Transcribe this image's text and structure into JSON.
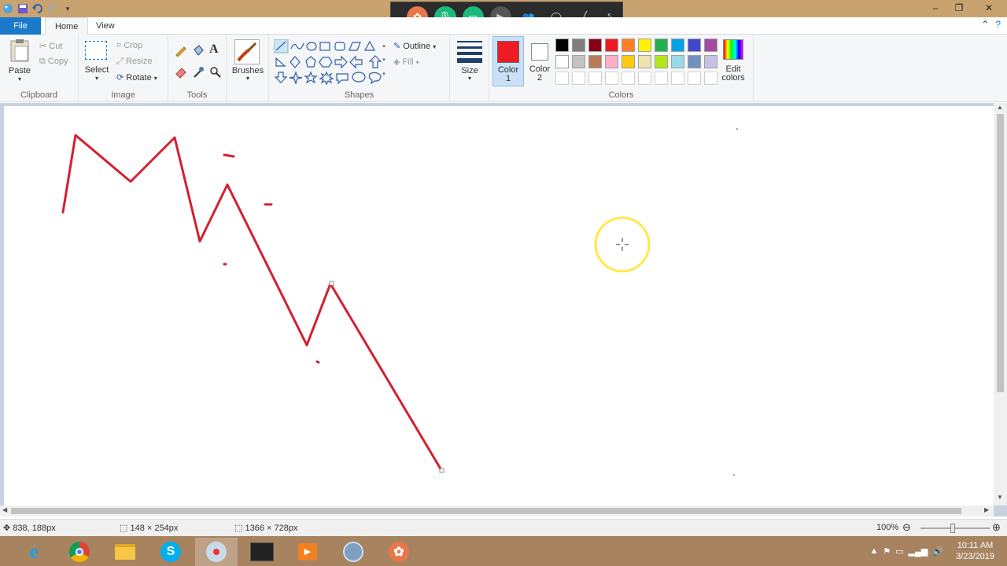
{
  "titlebar": {
    "quick_access": [
      "paint-icon",
      "save-icon",
      "undo-icon",
      "redo-icon",
      "customize-icon"
    ],
    "controls": [
      "–",
      "❐",
      "✕"
    ]
  },
  "tabs": {
    "file": "File",
    "home": "Home",
    "view": "View"
  },
  "ribbon": {
    "clipboard": {
      "paste": "Paste",
      "cut": "Cut",
      "copy": "Copy",
      "label": "Clipboard"
    },
    "image": {
      "select": "Select",
      "crop": "Crop",
      "resize": "Resize",
      "rotate": "Rotate",
      "label": "Image"
    },
    "tools": {
      "label": "Tools"
    },
    "brushes": {
      "label": "Brushes"
    },
    "shapes": {
      "outline": "Outline",
      "fill": "Fill",
      "label": "Shapes"
    },
    "size": {
      "label": "Size"
    },
    "colors": {
      "color1_label": "Color",
      "color1_num": "1",
      "color2_label": "Color",
      "color2_num": "2",
      "color1": "#ed1c24",
      "color2": "#ffffff",
      "edit_label1": "Edit",
      "edit_label2": "colors",
      "label": "Colors",
      "palette_row1": [
        "#000000",
        "#7f7f7f",
        "#880015",
        "#ed1c24",
        "#ff7f27",
        "#fff200",
        "#22b14c",
        "#00a2e8",
        "#3f48cc",
        "#a349a4"
      ],
      "palette_row2": [
        "#ffffff",
        "#c3c3c3",
        "#b97a57",
        "#ffaec9",
        "#ffc90e",
        "#efe4b0",
        "#b5e61d",
        "#99d9ea",
        "#7092be",
        "#c8bfe7"
      ]
    }
  },
  "status": {
    "cursor_pos": "838, 188px",
    "selection_size": "148 × 254px",
    "image_size": "1366 × 728px",
    "zoom": "100%"
  },
  "taskbar": {
    "apps": [
      "internet-explorer-icon",
      "chrome-icon",
      "file-explorer-icon",
      "skype-icon",
      "paint-icon",
      "forex-app-icon",
      "media-player-icon",
      "recorder-icon",
      "flower-app-icon"
    ],
    "time": "10:11 AM",
    "date": "3/23/2019"
  },
  "overlay_toolbar": {
    "buttons": [
      "flower-logo-icon",
      "microphone-icon",
      "screen-share-icon",
      "camera-icon",
      "people-icon",
      "chat-bubble-icon",
      "pen-icon",
      "expand-icon"
    ]
  },
  "drawing": {
    "stroke_color": "#d32030",
    "cursor_highlight": "#ffe94a"
  }
}
